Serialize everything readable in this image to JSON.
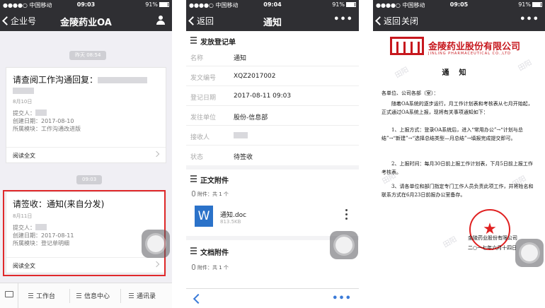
{
  "status": {
    "carrier": "●●●●○ 中国移动",
    "battery": "91%",
    "time1": "09:03",
    "time2": "09:04",
    "time3": "09:05"
  },
  "screen1": {
    "back_label": "企业号",
    "title": "金陵药业OA",
    "pill1": "昨天 08:54",
    "pill2": "09:03",
    "card1": {
      "title": "请查阅工作沟通回复：",
      "date": "8月10日",
      "submitter": "提交人：",
      "created": "创建日期：2017-08-10",
      "module": "所属模块：工作沟通改进版",
      "read": "阅读全文"
    },
    "card2": {
      "title": "请签收：通知(来自分发)",
      "date": "8月11日",
      "submitter": "提交人：",
      "created": "创建日期：2017-08-11",
      "module": "所属模块：登记单明细",
      "read": "阅读全文"
    },
    "tabs": [
      "工作台",
      "信息中心",
      "通讯录"
    ]
  },
  "screen2": {
    "back_label": "返回",
    "title": "通知",
    "more": "•••",
    "section1": "发放登记单",
    "rows": [
      {
        "label": "名称",
        "value": "通知"
      },
      {
        "label": "发文编号",
        "value": "XQZ2017002"
      },
      {
        "label": "登记日期",
        "value": "2017-08-11 09:03"
      },
      {
        "label": "发往单位",
        "value": "股份-信息部"
      },
      {
        "label": "接收人",
        "value": ""
      },
      {
        "label": "状态",
        "value": "待签收"
      }
    ],
    "section2": "正文附件",
    "attach_count": "附件：共 1 个",
    "file_name": "通知.doc",
    "file_size": "813.5KB",
    "section3": "文档附件",
    "attach_count2": "附件：共 1 个"
  },
  "screen3": {
    "back_label": "返回",
    "close_label": "关闭",
    "more": "•••",
    "company_cn": "金陵药业股份有限公司",
    "company_en": "JINLING PHARMACEUTICAL CO.,LTD",
    "notice_title": "通知",
    "watermark": "田阳",
    "addressee": "各单位、公司各部（室）：",
    "para1": "随着OA系统的逐步运行，月工作计划表和考核表从七月开始起，正式通过OA系统上报，现将有关事项通知如下：",
    "item1": "1、上报方式：登录OA系统后，进入“常用办公”→“计划与总结”→“新建”→“选择总结类型—月总结”→填报完成提交即可。",
    "item2": "2、上报时间：每月30日前上报工作计划表，下月5日前上报工作考核表。",
    "item3": "3、请各单位和部门指定专门工作人员负责此项工作，并将姓名和联系方式在6月23日前报办公室备存。",
    "sign": "金陵药业股份有限公司",
    "date": "二○一七年六月十四日"
  },
  "colors": {
    "navbar": "#2f2f33",
    "highlight": "#e0292b",
    "brand_red": "#c7181e",
    "link_blue": "#3b7bd8",
    "word_blue": "#2b72c9"
  }
}
